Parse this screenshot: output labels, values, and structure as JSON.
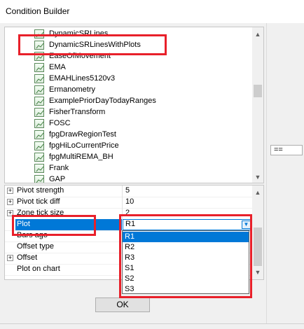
{
  "window": {
    "title": "Condition Builder"
  },
  "indicators": [
    {
      "label": "DynamicSRLines"
    },
    {
      "label": "DynamicSRLinesWithPlots"
    },
    {
      "label": "EaseOfMovement"
    },
    {
      "label": "EMA"
    },
    {
      "label": "EMAHLines5120v3"
    },
    {
      "label": "Ermanometry"
    },
    {
      "label": "ExamplePriorDayTodayRanges"
    },
    {
      "label": "FisherTransform"
    },
    {
      "label": "FOSC"
    },
    {
      "label": "fpgDrawRegionTest"
    },
    {
      "label": "fpgHiLoCurrentPrice"
    },
    {
      "label": "fpgMultiREMA_BH"
    },
    {
      "label": "Frank"
    },
    {
      "label": "GAP"
    }
  ],
  "properties": [
    {
      "expand": "+",
      "name": "Pivot strength",
      "value": "5"
    },
    {
      "expand": "+",
      "name": "Pivot tick diff",
      "value": "10"
    },
    {
      "expand": "+",
      "name": "Zone tick size",
      "value": "2"
    },
    {
      "expand": "",
      "name": "Plot",
      "value": "R1"
    },
    {
      "expand": "",
      "name": "Bars ago",
      "value": ""
    },
    {
      "expand": "",
      "name": "Offset type",
      "value": ""
    },
    {
      "expand": "+",
      "name": "Offset",
      "value": ""
    },
    {
      "expand": "",
      "name": "Plot on chart",
      "value": ""
    }
  ],
  "plot_dropdown": {
    "selected": "R1",
    "options": [
      "R1",
      "R2",
      "R3",
      "S1",
      "S2",
      "S3"
    ]
  },
  "operator_button": {
    "label": "=="
  },
  "ok_button": {
    "label": "OK"
  },
  "colors": {
    "accent": "#0078d7",
    "highlight": "#e8202a"
  }
}
